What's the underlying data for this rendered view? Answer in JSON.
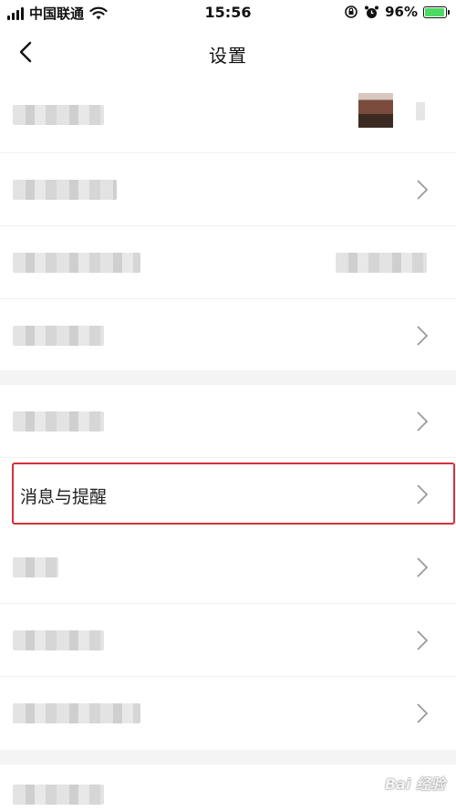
{
  "status_bar": {
    "carrier": "中国联通",
    "time": "15:56",
    "battery_percent": "96%",
    "battery_level": 0.96,
    "icons": [
      "signal-icon",
      "wifi-icon",
      "orientation-lock-icon",
      "alarm-icon",
      "battery-icon"
    ]
  },
  "nav": {
    "title": "设置",
    "back_icon": "chevron-left-icon"
  },
  "settings": {
    "highlighted_item_label": "消息与提醒"
  },
  "watermark": {
    "text": "Bai 经验"
  },
  "colors": {
    "highlight_border": "#d6313a",
    "battery_fill": "#4cd964",
    "separator": "#f4f4f4"
  }
}
